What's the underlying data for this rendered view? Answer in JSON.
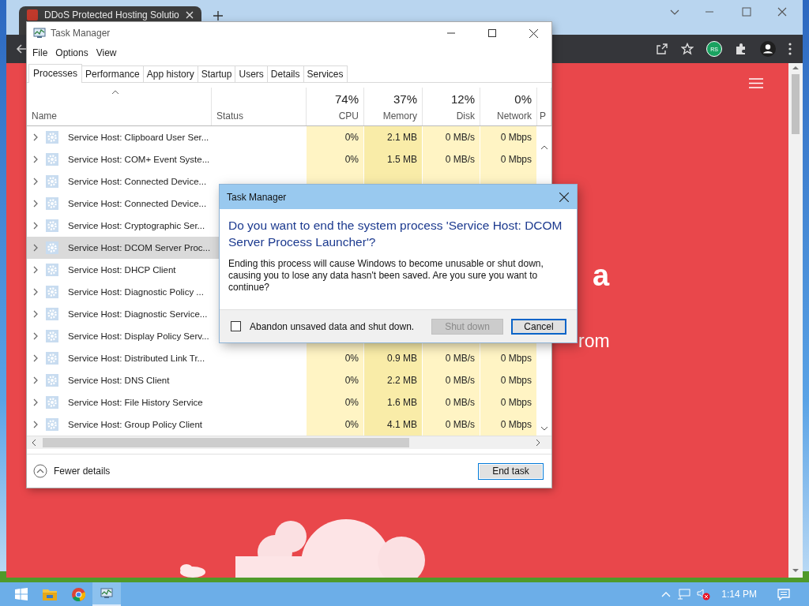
{
  "browser": {
    "tab_title": "DDoS Protected Hosting Solutio",
    "extension_badge": "RS",
    "page_texts": [
      {
        "kind": "heading",
        "text": "a"
      },
      {
        "kind": "subheading",
        "text": "rom"
      }
    ]
  },
  "task_manager": {
    "title": "Task Manager",
    "menu": [
      "File",
      "Options",
      "View"
    ],
    "tabs": [
      {
        "label": "Processes",
        "selected": true
      },
      {
        "label": "Performance",
        "selected": false
      },
      {
        "label": "App history",
        "selected": false
      },
      {
        "label": "Startup",
        "selected": false
      },
      {
        "label": "Users",
        "selected": false
      },
      {
        "label": "Details",
        "selected": false
      },
      {
        "label": "Services",
        "selected": false
      }
    ],
    "columns": [
      {
        "label": "Name",
        "sorted": true
      },
      {
        "label": "Status",
        "sorted": false
      },
      {
        "label": "CPU",
        "reading": "74%",
        "sorted": false
      },
      {
        "label": "Memory",
        "reading": "37%",
        "sorted": false
      },
      {
        "label": "Disk",
        "reading": "12%",
        "sorted": false
      },
      {
        "label": "Network",
        "reading": "0%",
        "sorted": false
      },
      {
        "label": "P",
        "sorted": false
      }
    ],
    "rows": [
      {
        "name": "Service Host: Clipboard User Ser...",
        "selected": false,
        "values": [
          "0%",
          "2.1 MB",
          "0 MB/s",
          "0 Mbps"
        ]
      },
      {
        "name": "Service Host: COM+ Event Syste...",
        "selected": false,
        "values": [
          "0%",
          "1.5 MB",
          "0 MB/s",
          "0 Mbps"
        ]
      },
      {
        "name": "Service Host: Connected Device...",
        "selected": false
      },
      {
        "name": "Service Host: Connected Device...",
        "selected": false
      },
      {
        "name": "Service Host: Cryptographic Ser...",
        "selected": false
      },
      {
        "name": "Service Host: DCOM Server Proc...",
        "selected": true
      },
      {
        "name": "Service Host: DHCP Client",
        "selected": false
      },
      {
        "name": "Service Host: Diagnostic Policy ...",
        "selected": false
      },
      {
        "name": "Service Host: Diagnostic Service...",
        "selected": false
      },
      {
        "name": "Service Host: Display Policy Serv...",
        "selected": false
      },
      {
        "name": "Service Host: Distributed Link Tr...",
        "selected": false,
        "values": [
          "0%",
          "0.9 MB",
          "0 MB/s",
          "0 Mbps"
        ]
      },
      {
        "name": "Service Host: DNS Client",
        "selected": false,
        "values": [
          "0%",
          "2.2 MB",
          "0 MB/s",
          "0 Mbps"
        ]
      },
      {
        "name": "Service Host: File History Service",
        "selected": false,
        "values": [
          "0%",
          "1.6 MB",
          "0 MB/s",
          "0 Mbps"
        ]
      },
      {
        "name": "Service Host: Group Policy Client",
        "selected": false,
        "values": [
          "0%",
          "4.1 MB",
          "0 MB/s",
          "0 Mbps"
        ]
      }
    ],
    "details_toggle": "Fewer details",
    "end_task": "End task"
  },
  "dialog": {
    "title": "Task Manager",
    "heading": "Do you want to end the system process 'Service Host: DCOM Server Process Launcher'?",
    "message": "Ending this process will cause Windows to become unusable or shut down, causing you to lose any data hasn't been saved. Are you sure you want to continue?",
    "checkbox": {
      "label": "Abandon unsaved data and shut down.",
      "checked": false
    },
    "buttons": [
      {
        "label": "Shut down",
        "disabled": true,
        "focused": false
      },
      {
        "label": "Cancel",
        "disabled": false,
        "focused": true
      }
    ]
  },
  "taskbar": {
    "apps": [
      {
        "kind": "start",
        "active": false
      },
      {
        "kind": "folder",
        "active": false
      },
      {
        "kind": "browser",
        "active": false
      },
      {
        "kind": "taskmanager",
        "active": true
      }
    ],
    "time": "1:14 PM"
  }
}
